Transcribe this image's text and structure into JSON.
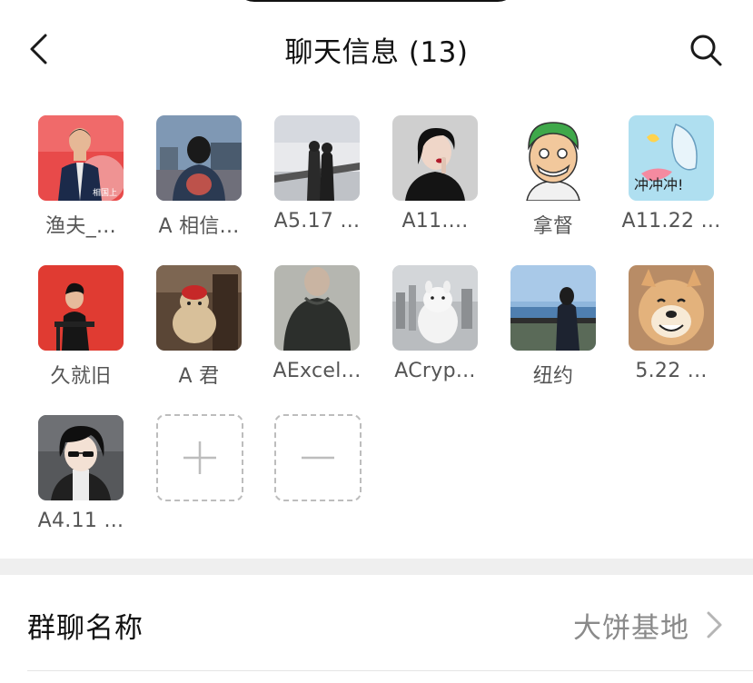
{
  "header": {
    "title": "聊天信息 (13)",
    "back_icon": "chevron-left-icon",
    "search_icon": "search-icon"
  },
  "members": [
    {
      "name": "渔夫_...",
      "avatar_icon": "avatar-man-in-suit"
    },
    {
      "name": "A 相信...",
      "avatar_icon": "avatar-person-back"
    },
    {
      "name": "A5.17 ...",
      "avatar_icon": "avatar-couple-snow"
    },
    {
      "name": "A11....",
      "avatar_icon": "avatar-woman-dark"
    },
    {
      "name": "拿督",
      "avatar_icon": "avatar-cartoon-green-hair"
    },
    {
      "name": "A11.22 ...",
      "avatar_icon": "avatar-cartoon-bird",
      "avatar_text": "冲冲冲!"
    },
    {
      "name": "久就旧",
      "avatar_icon": "avatar-man-red-bg"
    },
    {
      "name": "A 君",
      "avatar_icon": "avatar-plush-toy"
    },
    {
      "name": "AExcel...",
      "avatar_icon": "avatar-sweater"
    },
    {
      "name": "ACryp...",
      "avatar_icon": "avatar-moomin-city"
    },
    {
      "name": "纽约",
      "avatar_icon": "avatar-man-sea"
    },
    {
      "name": "5.22 ...",
      "avatar_icon": "avatar-shiba-dog"
    },
    {
      "name": "A4.11 ...",
      "avatar_icon": "avatar-anime-boy"
    }
  ],
  "actions": {
    "add_icon": "plus-icon",
    "remove_icon": "minus-icon"
  },
  "settings": {
    "group_name_label": "群聊名称",
    "group_name_value": "大饼基地",
    "chevron_icon": "chevron-right-icon"
  }
}
